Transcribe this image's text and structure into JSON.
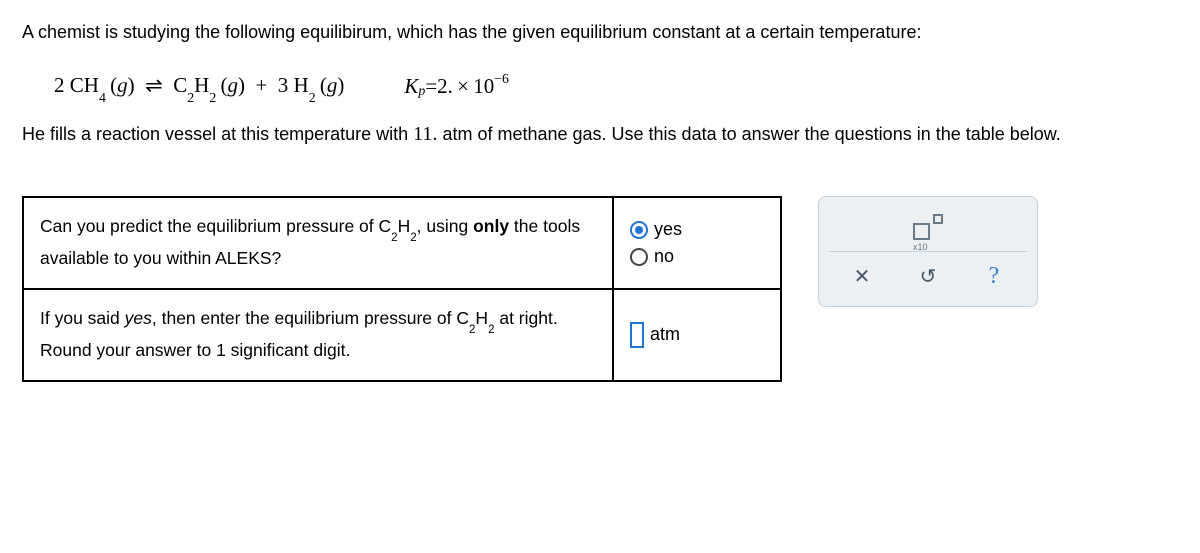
{
  "problem": {
    "intro": "A chemist is studying the following equilibirum, which has the given equilibrium constant at a certain temperature:",
    "fill_text_a": "He fills a reaction vessel at this temperature with ",
    "fill_value": "11.",
    "fill_text_b": " atm of methane gas. Use this data to answer the questions in the table below."
  },
  "equation": {
    "lhs_coef": "2",
    "lhs_species": "CH",
    "lhs_sub": "4",
    "phase": "g",
    "rl": "⇌",
    "rhs1_species": "C",
    "rhs1_sub1": "2",
    "rhs1_species2": "H",
    "rhs1_sub2": "2",
    "plus": "+",
    "rhs2_coef": "3",
    "rhs2_species": "H",
    "rhs2_sub": "2",
    "kp_label_k": "K",
    "kp_label_p": "p",
    "kp_eq": "=",
    "kp_mant": "2.",
    "kp_times": "×",
    "kp_base": "10",
    "kp_exp": "−6"
  },
  "questions": {
    "q1_a": "Can you predict the equilibrium pressure of C",
    "q1_sub1": "2",
    "q1_b": "H",
    "q1_sub2": "2",
    "q1_c": ", using ",
    "q1_only": "only",
    "q1_d": " the tools available to you within ALEKS?",
    "yes": "yes",
    "no": "no",
    "q2_a": "If you said ",
    "q2_yes": "yes",
    "q2_b": ", then enter the equilibrium pressure of C",
    "q2_sub1": "2",
    "q2_c": "H",
    "q2_sub2": "2",
    "q2_d": " at right. Round your answer to 1 significant digit.",
    "atm_label": "atm"
  },
  "tools": {
    "x10_label": "x10",
    "close": "✕",
    "redo": "↺",
    "help": "?"
  }
}
